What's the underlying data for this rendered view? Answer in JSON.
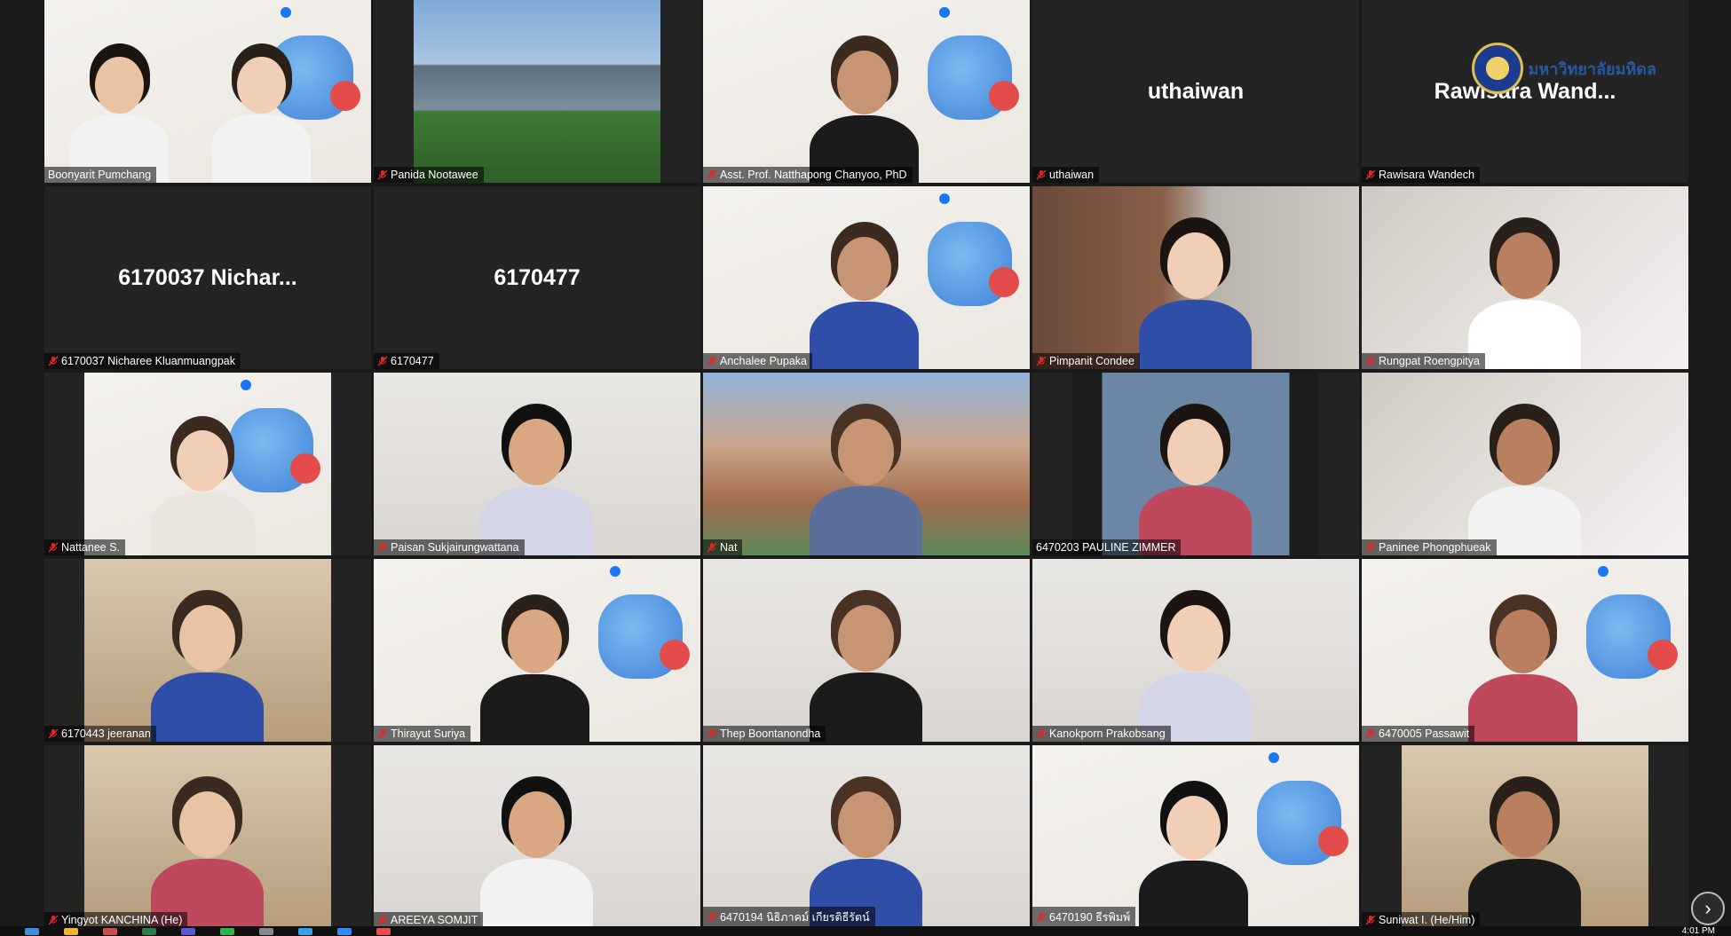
{
  "meeting": {
    "tiles": [
      {
        "name": "Boonyarit Pumchang",
        "muted": false,
        "active": true,
        "video": "poster-two"
      },
      {
        "name": "Panida Nootawee",
        "muted": true,
        "video": "building"
      },
      {
        "name": "Asst. Prof. Natthapong Chanyoo, PhD",
        "muted": true,
        "video": "poster-person"
      },
      {
        "name": "uthaiwan",
        "muted": true,
        "video": "none",
        "display_name": "uthaiwan"
      },
      {
        "name": "Rawisara Wandech",
        "muted": true,
        "video": "logo",
        "display_name": "Rawisara  Wand..."
      },
      {
        "name": "6170037 Nicharee Kluanmuangpak",
        "muted": true,
        "video": "none",
        "display_name": "6170037  Nichar..."
      },
      {
        "name": "6170477",
        "muted": true,
        "video": "none",
        "display_name": "6170477"
      },
      {
        "name": "Anchalee Pupaka",
        "muted": true,
        "video": "poster-person"
      },
      {
        "name": "Pimpanit Condee",
        "muted": true,
        "video": "office"
      },
      {
        "name": "Rungpat Roengpitya",
        "muted": true,
        "video": "room"
      },
      {
        "name": "Nattanee S.",
        "muted": true,
        "video": "poster-masked"
      },
      {
        "name": "Paisan  Sukjairungwattana",
        "muted": true,
        "video": "room-light"
      },
      {
        "name": "Nat",
        "muted": true,
        "video": "town"
      },
      {
        "name": "6470203 PAULINE ZIMMER",
        "muted": false,
        "video": "blue-room"
      },
      {
        "name": "Paninee Phongphueak",
        "muted": true,
        "video": "room"
      },
      {
        "name": "6170443 jeeranan",
        "muted": true,
        "video": "home"
      },
      {
        "name": "Thirayut Suriya",
        "muted": true,
        "video": "poster-person"
      },
      {
        "name": "Thep Boontanondha",
        "muted": true,
        "video": "room-light"
      },
      {
        "name": "Kanokporn Prakobsang",
        "muted": true,
        "video": "room-light"
      },
      {
        "name": "6470005 Passawit",
        "muted": true,
        "video": "poster-person"
      },
      {
        "name": "Yingyot KANCHINA (He)",
        "muted": true,
        "video": "home"
      },
      {
        "name": "AREEYA SOMJIT",
        "muted": true,
        "video": "room-light"
      },
      {
        "name": "6470194 นิธิภาคม์ เกียรติธีรัตน์",
        "muted": true,
        "video": "room-light"
      },
      {
        "name": "6470190 ธีรพิมพ์",
        "muted": true,
        "video": "poster-person"
      },
      {
        "name": "Suniwat I. (He/Him)",
        "muted": true,
        "video": "home"
      }
    ],
    "overlay_logo_text": "มหาวิทยาลัยมหิดล",
    "next_page_icon": "chevron-right-icon"
  },
  "taskbar": {
    "clock": "4:01 PM",
    "icons": [
      "#3c8dde",
      "#f2b233",
      "#c94f4f",
      "#2d7d46",
      "#5a5ad6",
      "#2fb44a",
      "#888888",
      "#3aa0f0",
      "#2d8cff",
      "#e94d4d"
    ]
  },
  "colors": {
    "active_speaker": "#e6d600",
    "muted_icon": "#e02828"
  }
}
